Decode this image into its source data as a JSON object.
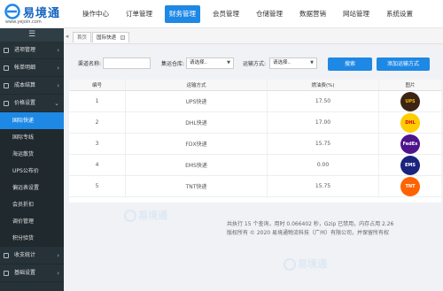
{
  "header": {
    "logo_name": "易境通",
    "logo_url": "www.yejoin.com",
    "nav": [
      "操作中心",
      "订单管理",
      "财务管理",
      "会员管理",
      "仓储管理",
      "数据营销",
      "网站管理",
      "系统设置"
    ],
    "active_nav": "财务管理"
  },
  "sidebar": {
    "toggle_icon": "☰",
    "groups_top": [
      {
        "label": "进项管理",
        "icon": "folder-icon"
      },
      {
        "label": "帐单明细",
        "icon": "folder-icon"
      },
      {
        "label": "成本结算",
        "icon": "folder-icon"
      },
      {
        "label": "价格设置",
        "icon": "folder-icon"
      }
    ],
    "sub_items": [
      "国际快递",
      "国际专线",
      "海运散货",
      "UPS公布价",
      "偏远表设置",
      "会员折扣",
      "调价管理",
      "积分验货"
    ],
    "active_sub": "国际快递",
    "groups_bottom": [
      {
        "label": "收支统计",
        "icon": "folder-icon"
      },
      {
        "label": "基础设置",
        "icon": "folder-icon"
      }
    ]
  },
  "tabs": [
    {
      "label": "首页",
      "closable": false
    },
    {
      "label": "国际快递",
      "closable": true
    }
  ],
  "search": {
    "channel_label": "渠道名称:",
    "channel_value": "",
    "warehouse_label": "集运仓库:",
    "warehouse_value": "请选择..",
    "method_label": "运输方式:",
    "method_value": "请选择..",
    "search_button": "搜索",
    "add_button": "添加运输方式"
  },
  "table": {
    "columns": [
      "编号",
      "运输方式",
      "燃油费(%)",
      "图片"
    ],
    "rows": [
      {
        "id": "1",
        "method": "UPS快递",
        "fuel": "17.50",
        "logo": "UPS",
        "logo_bg": "#3b2415",
        "logo_fg": "#f5b400"
      },
      {
        "id": "2",
        "method": "DHL快递",
        "fuel": "17.00",
        "logo": "DHL",
        "logo_bg": "#ffcc00",
        "logo_fg": "#d40511"
      },
      {
        "id": "3",
        "method": "FDX快递",
        "fuel": "15.75",
        "logo": "FedEx",
        "logo_bg": "#4d148c",
        "logo_fg": "#ffffff"
      },
      {
        "id": "4",
        "method": "EMS快递",
        "fuel": "0.00",
        "logo": "EMS",
        "logo_bg": "#1a237e",
        "logo_fg": "#ffffff"
      },
      {
        "id": "5",
        "method": "TNT快递",
        "fuel": "15.75",
        "logo": "TNT",
        "logo_bg": "#ff6200",
        "logo_fg": "#ffffff"
      }
    ]
  },
  "footer": {
    "line1": "共执行 15 个查询，用时 0.066402 秒，Gzip 已禁用，内存占用 2.26",
    "line2": "版权所有 © 2020 易境通物流科技（广州）有限公司，并保留所有权"
  },
  "colors": {
    "accent": "#1e88e5",
    "sidebar": "#263238"
  },
  "watermark_text": "易境通"
}
